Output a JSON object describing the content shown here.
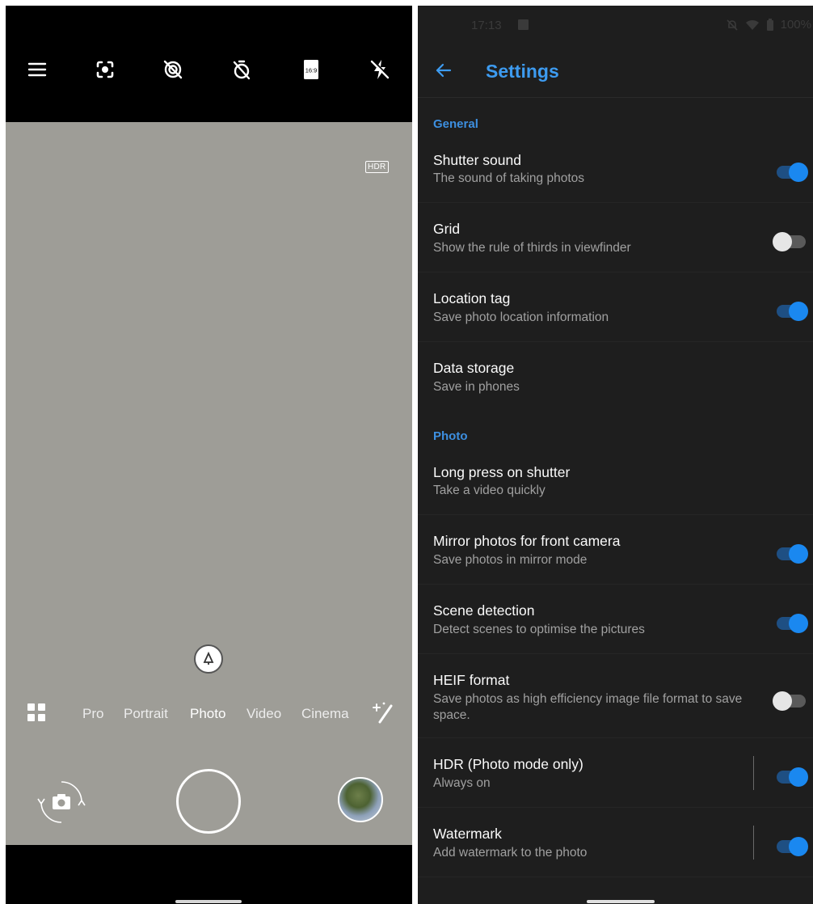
{
  "camera": {
    "top_icons": [
      "menu-icon",
      "focus-mode-icon",
      "filter-off-icon",
      "timer-off-icon",
      "aspect-ratio-icon",
      "flash-off-icon"
    ],
    "aspect_ratio_label": "16:9",
    "hdr_badge": "HDR",
    "modes": [
      "Pro",
      "Portrait",
      "Photo",
      "Video",
      "Cinema"
    ],
    "active_mode": "Photo"
  },
  "settings": {
    "status": {
      "time": "17:13",
      "battery": "100%"
    },
    "title": "Settings",
    "sections": [
      {
        "header": "General",
        "items": [
          {
            "title": "Shutter sound",
            "subtitle": "The sound of taking photos",
            "toggle": "on"
          },
          {
            "title": "Grid",
            "subtitle": "Show the rule of thirds in viewfinder",
            "toggle": "off"
          },
          {
            "title": "Location tag",
            "subtitle": "Save photo location information",
            "toggle": "on"
          },
          {
            "title": "Data storage",
            "subtitle": "Save in phones"
          }
        ]
      },
      {
        "header": "Photo",
        "items": [
          {
            "title": "Long press on shutter",
            "subtitle": "Take a video quickly"
          },
          {
            "title": "Mirror photos for front camera",
            "subtitle": "Save photos in mirror mode",
            "toggle": "on"
          },
          {
            "title": "Scene detection",
            "subtitle": "Detect scenes to optimise the pictures",
            "toggle": "on"
          },
          {
            "title": "HEIF format",
            "subtitle": "Save photos as high efficiency image file format to save space.",
            "toggle": "off"
          },
          {
            "title": "HDR (Photo mode only)",
            "subtitle": "Always on",
            "toggle": "on"
          },
          {
            "title": "Watermark",
            "subtitle": "Add watermark to the photo",
            "toggle": "on"
          }
        ]
      }
    ]
  },
  "colors": {
    "accent": "#3d9bf0",
    "toggle_on": "#1a88f0",
    "settings_bg": "#1e1e1e",
    "viewfinder": "#9e9d97"
  }
}
